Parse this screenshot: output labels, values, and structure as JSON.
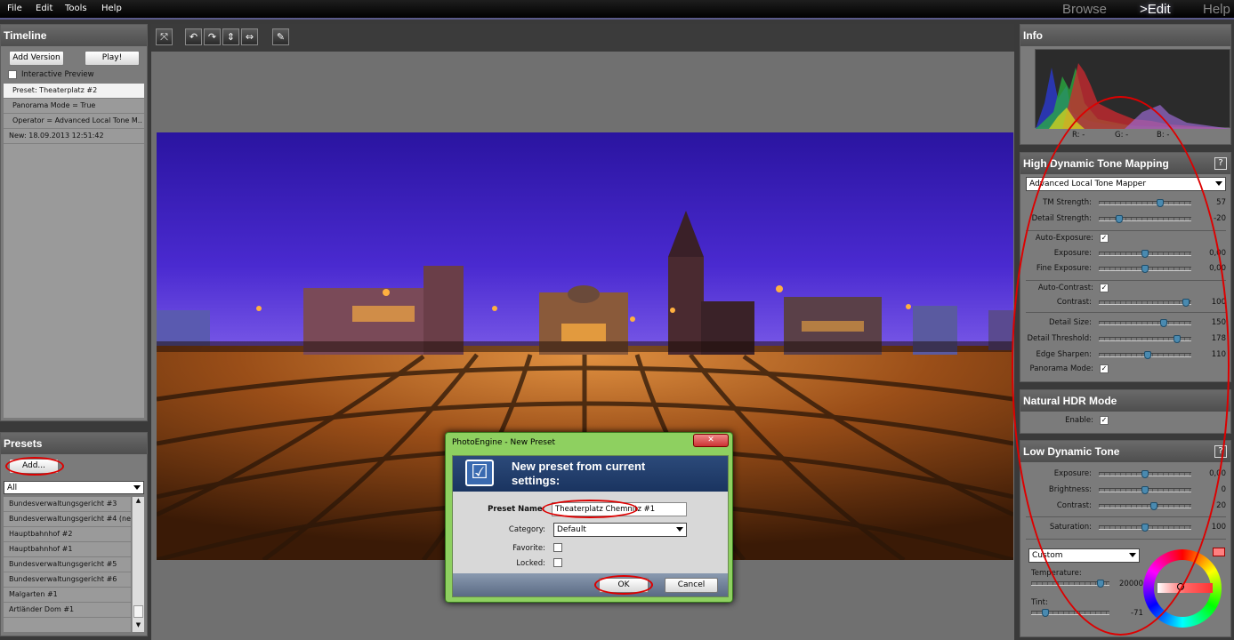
{
  "menu": {
    "file": "File",
    "edit": "Edit",
    "tools": "Tools",
    "help": "Help"
  },
  "modes": {
    "browse": "Browse",
    "edit": ">Edit",
    "help": "Help"
  },
  "timeline": {
    "title": "Timeline",
    "add_version": "Add Version",
    "play": "Play!",
    "interactive_preview": "Interactive Preview",
    "items": [
      "Preset: Theaterplatz #2",
      "Panorama Mode = True",
      "Operator = Advanced Local Tone M..",
      "New: 18.09.2013 12:51:42"
    ]
  },
  "presets": {
    "title": "Presets",
    "add": "Add...",
    "filter": "All",
    "items": [
      "Bundesverwaltungsgericht #3",
      "Bundesverwaltungsgericht #4 (ne...",
      "Hauptbahnhof #2",
      "Hauptbahnhof #1",
      "Bundesverwaltungsgericht #5",
      "Bundesverwaltungsgericht #6",
      "Malgarten #1",
      "Artländer Dom #1"
    ]
  },
  "toolbar": {
    "icons": [
      "fit-icon",
      "rotate-left-icon",
      "rotate-right-icon",
      "flip-vertical-icon",
      "flip-horizontal-icon",
      "eyedropper-icon"
    ]
  },
  "info": {
    "title": "Info",
    "r": "R: -",
    "g": "G: -",
    "b": "B: -"
  },
  "hdr": {
    "title": "High Dynamic Tone Mapping",
    "help": "?",
    "operator": "Advanced Local Tone Mapper",
    "tm_strength_label": "TM Strength:",
    "tm_strength": "57",
    "tm_strength_level": 0.68,
    "detail_strength_label": "Detail Strength:",
    "detail_strength": "-20",
    "detail_strength_level": 0.2,
    "auto_exposure_label": "Auto-Exposure:",
    "exposure_label": "Exposure:",
    "exposure": "0,00",
    "exposure_level": 0.5,
    "fine_exposure_label": "Fine Exposure:",
    "fine_exposure": "0,00",
    "fine_exposure_level": 0.5,
    "auto_contrast_label": "Auto-Contrast:",
    "contrast_label": "Contrast:",
    "contrast": "100",
    "contrast_level": 0.98,
    "detail_size_label": "Detail Size:",
    "detail_size": "150",
    "detail_size_level": 0.72,
    "detail_threshold_label": "Detail Threshold:",
    "detail_threshold": "178",
    "detail_threshold_level": 0.87,
    "edge_sharpen_label": "Edge Sharpen:",
    "edge_sharpen": "110",
    "edge_sharpen_level": 0.53,
    "panorama_mode_label": "Panorama Mode:",
    "check": "✓"
  },
  "natural": {
    "title": "Natural HDR Mode",
    "enable_label": "Enable:"
  },
  "ldt": {
    "title": "Low Dynamic Tone",
    "help": "?",
    "exposure_label": "Exposure:",
    "exposure": "0,00",
    "exposure_level": 0.5,
    "brightness_label": "Brightness:",
    "brightness": "0",
    "brightness_level": 0.5,
    "contrast_label": "Contrast:",
    "contrast": "20",
    "contrast_level": 0.6,
    "saturation_label": "Saturation:",
    "saturation": "100",
    "saturation_level": 0.5,
    "wb_mode": "Custom",
    "temperature_label": "Temperature:",
    "temperature": "20000",
    "temperature_level": 0.92,
    "tint_label": "Tint:",
    "tint": "-71",
    "tint_level": 0.15
  },
  "dialog": {
    "window_title": "PhotoEngine - New Preset",
    "heading": "New preset from current settings:",
    "name_label": "Preset Name:",
    "name_value": "Theaterplatz Chemnitz #1",
    "category_label": "Category:",
    "category_value": "Default",
    "favorite_label": "Favorite:",
    "locked_label": "Locked:",
    "ok": "OK",
    "cancel": "Cancel",
    "close": "✕"
  },
  "colors": {
    "accent_red": "#dd0000",
    "sky_top": "#2a1aa8",
    "plaza": "#a05a22",
    "dialog_frame": "#7ec850"
  }
}
